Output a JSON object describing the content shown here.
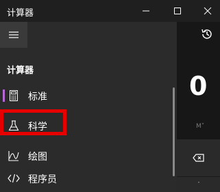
{
  "window": {
    "title": "计算器",
    "minimize_icon": "minimize-icon",
    "maximize_icon": "maximize-icon",
    "close_icon": "close-icon"
  },
  "nav": {
    "heading": "计算器",
    "items": [
      {
        "label": "标准",
        "icon": "standard-calculator-icon",
        "selected": true
      },
      {
        "label": "科学",
        "icon": "flask-icon",
        "selected": false,
        "highlighted": true
      },
      {
        "label": "绘图",
        "icon": "graph-icon",
        "selected": false
      },
      {
        "label": "程序员",
        "icon": "code-icon",
        "selected": false
      }
    ]
  },
  "calculator": {
    "display": "0",
    "memory_label": "M˅"
  },
  "colors": {
    "accent": "#b469d4",
    "highlight": "#e60000",
    "nav_background": "#2b2b2b",
    "app_background": "#1e1e1e"
  }
}
